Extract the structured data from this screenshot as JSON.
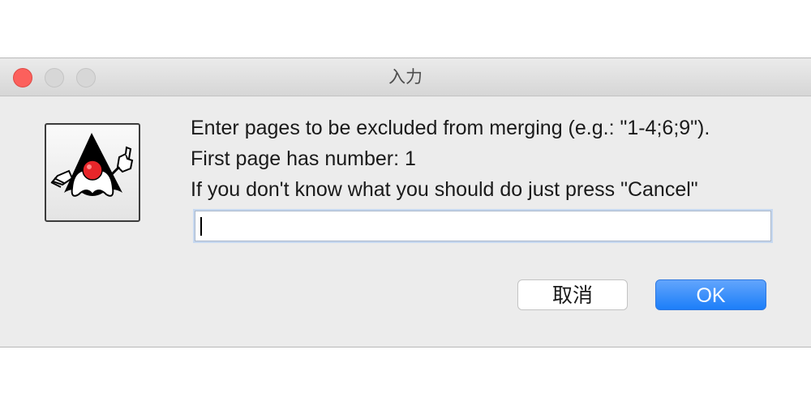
{
  "window": {
    "title": "入力"
  },
  "dialog": {
    "icon": "java-duke-icon",
    "message_lines": [
      "Enter pages to be excluded from merging (e.g.: \"1-4;6;9\").",
      "First page has number: 1",
      "If you don't know what you should do just press \"Cancel\""
    ],
    "input_value": "",
    "cancel_label": "取消",
    "ok_label": "OK"
  },
  "colors": {
    "close_button": "#fc605c",
    "default_button": "#1c7ef9",
    "dialog_background": "#ececec",
    "input_focus_ring": "#c6d8f0"
  }
}
